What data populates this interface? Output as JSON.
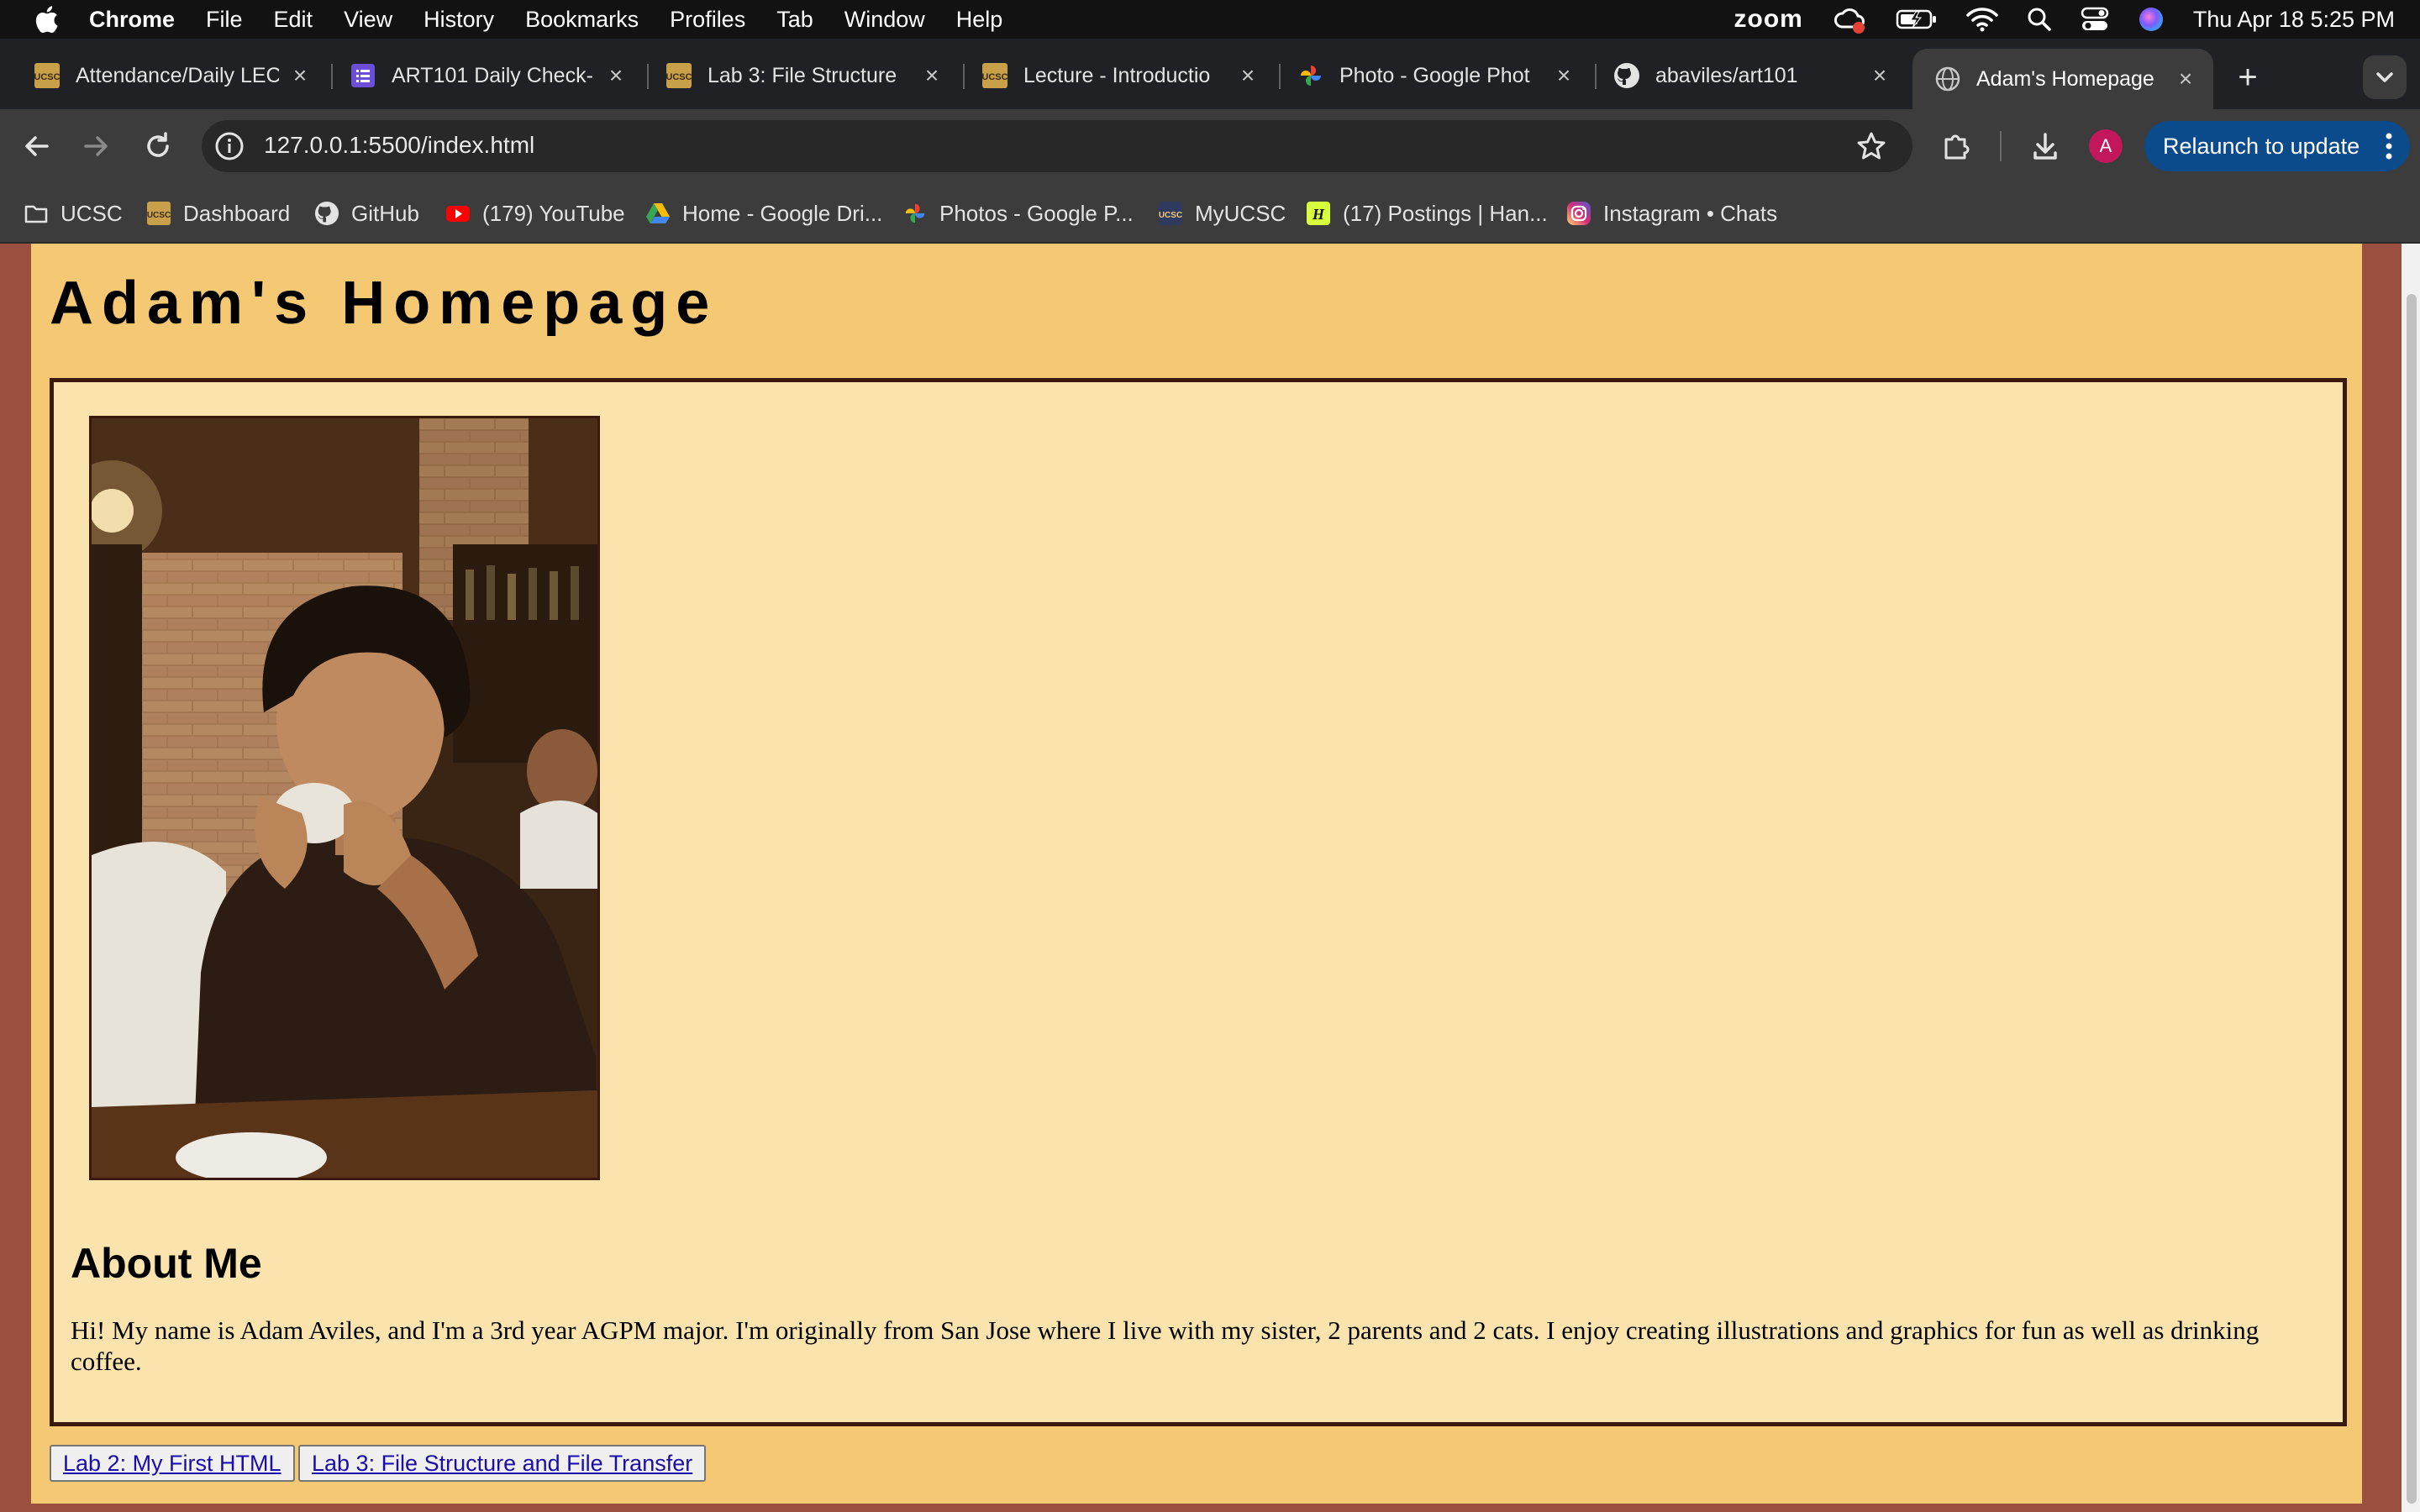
{
  "menubar": {
    "app_name": "Chrome",
    "items": [
      "File",
      "Edit",
      "View",
      "History",
      "Bookmarks",
      "Profiles",
      "Tab",
      "Window",
      "Help"
    ],
    "zoom_label": "zoom",
    "clock": "Thu Apr 18  5:25 PM"
  },
  "tabs": [
    {
      "title": "Attendance/Daily LEC",
      "icon": "ucsc-canvas-icon"
    },
    {
      "title": "ART101 Daily Check-",
      "icon": "form-list-icon"
    },
    {
      "title": "Lab 3: File Structure",
      "icon": "ucsc-canvas-icon"
    },
    {
      "title": "Lecture - Introductio",
      "icon": "ucsc-canvas-icon"
    },
    {
      "title": "Photo - Google Phot",
      "icon": "google-photos-icon"
    },
    {
      "title": "abaviles/art101",
      "icon": "github-icon"
    },
    {
      "title": "Adam's Homepage",
      "icon": "globe-icon"
    }
  ],
  "toolbar": {
    "url": "127.0.0.1:5500/index.html",
    "profile_initial": "A",
    "relaunch_label": "Relaunch to update"
  },
  "bookmarks": [
    {
      "label": "UCSC",
      "icon": "folder-icon"
    },
    {
      "label": "Dashboard",
      "icon": "ucsc-canvas-icon"
    },
    {
      "label": "GitHub",
      "icon": "github-icon"
    },
    {
      "label": "(179) YouTube",
      "icon": "youtube-icon"
    },
    {
      "label": "Home - Google Dri...",
      "icon": "google-drive-icon"
    },
    {
      "label": "Photos - Google P...",
      "icon": "google-photos-icon"
    },
    {
      "label": "MyUCSC",
      "icon": "ucsc-icon"
    },
    {
      "label": "(17) Postings | Han...",
      "icon": "handshake-icon"
    },
    {
      "label": "Instagram • Chats",
      "icon": "instagram-icon"
    }
  ],
  "page": {
    "title": "Adam's Homepage",
    "about_heading": "About Me",
    "about_text": "Hi! My name is Adam Aviles, and I'm a 3rd year AGPM major. I'm originally from San Jose where I live with my sister, 2 parents and 2 cats. I enjoy creating illustrations and graphics for fun as well as drinking coffee.",
    "links": [
      "Lab 2: My First HTML",
      "Lab 3: File Structure and File Transfer"
    ]
  },
  "colors": {
    "page_background": "#9b4f3f",
    "header_background": "#f5c873",
    "content_background": "#fae3ad",
    "content_border": "#3a1a0d",
    "relaunch_button": "#0b4a8b"
  }
}
